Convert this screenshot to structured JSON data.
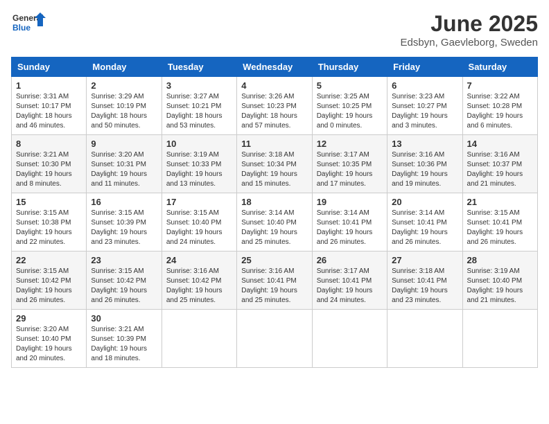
{
  "header": {
    "logo_general": "General",
    "logo_blue": "Blue",
    "title": "June 2025",
    "subtitle": "Edsbyn, Gaevleborg, Sweden"
  },
  "days_of_week": [
    "Sunday",
    "Monday",
    "Tuesday",
    "Wednesday",
    "Thursday",
    "Friday",
    "Saturday"
  ],
  "weeks": [
    [
      {
        "day": "1",
        "info": "Sunrise: 3:31 AM\nSunset: 10:17 PM\nDaylight: 18 hours\nand 46 minutes."
      },
      {
        "day": "2",
        "info": "Sunrise: 3:29 AM\nSunset: 10:19 PM\nDaylight: 18 hours\nand 50 minutes."
      },
      {
        "day": "3",
        "info": "Sunrise: 3:27 AM\nSunset: 10:21 PM\nDaylight: 18 hours\nand 53 minutes."
      },
      {
        "day": "4",
        "info": "Sunrise: 3:26 AM\nSunset: 10:23 PM\nDaylight: 18 hours\nand 57 minutes."
      },
      {
        "day": "5",
        "info": "Sunrise: 3:25 AM\nSunset: 10:25 PM\nDaylight: 19 hours\nand 0 minutes."
      },
      {
        "day": "6",
        "info": "Sunrise: 3:23 AM\nSunset: 10:27 PM\nDaylight: 19 hours\nand 3 minutes."
      },
      {
        "day": "7",
        "info": "Sunrise: 3:22 AM\nSunset: 10:28 PM\nDaylight: 19 hours\nand 6 minutes."
      }
    ],
    [
      {
        "day": "8",
        "info": "Sunrise: 3:21 AM\nSunset: 10:30 PM\nDaylight: 19 hours\nand 8 minutes."
      },
      {
        "day": "9",
        "info": "Sunrise: 3:20 AM\nSunset: 10:31 PM\nDaylight: 19 hours\nand 11 minutes."
      },
      {
        "day": "10",
        "info": "Sunrise: 3:19 AM\nSunset: 10:33 PM\nDaylight: 19 hours\nand 13 minutes."
      },
      {
        "day": "11",
        "info": "Sunrise: 3:18 AM\nSunset: 10:34 PM\nDaylight: 19 hours\nand 15 minutes."
      },
      {
        "day": "12",
        "info": "Sunrise: 3:17 AM\nSunset: 10:35 PM\nDaylight: 19 hours\nand 17 minutes."
      },
      {
        "day": "13",
        "info": "Sunrise: 3:16 AM\nSunset: 10:36 PM\nDaylight: 19 hours\nand 19 minutes."
      },
      {
        "day": "14",
        "info": "Sunrise: 3:16 AM\nSunset: 10:37 PM\nDaylight: 19 hours\nand 21 minutes."
      }
    ],
    [
      {
        "day": "15",
        "info": "Sunrise: 3:15 AM\nSunset: 10:38 PM\nDaylight: 19 hours\nand 22 minutes."
      },
      {
        "day": "16",
        "info": "Sunrise: 3:15 AM\nSunset: 10:39 PM\nDaylight: 19 hours\nand 23 minutes."
      },
      {
        "day": "17",
        "info": "Sunrise: 3:15 AM\nSunset: 10:40 PM\nDaylight: 19 hours\nand 24 minutes."
      },
      {
        "day": "18",
        "info": "Sunrise: 3:14 AM\nSunset: 10:40 PM\nDaylight: 19 hours\nand 25 minutes."
      },
      {
        "day": "19",
        "info": "Sunrise: 3:14 AM\nSunset: 10:41 PM\nDaylight: 19 hours\nand 26 minutes."
      },
      {
        "day": "20",
        "info": "Sunrise: 3:14 AM\nSunset: 10:41 PM\nDaylight: 19 hours\nand 26 minutes."
      },
      {
        "day": "21",
        "info": "Sunrise: 3:15 AM\nSunset: 10:41 PM\nDaylight: 19 hours\nand 26 minutes."
      }
    ],
    [
      {
        "day": "22",
        "info": "Sunrise: 3:15 AM\nSunset: 10:42 PM\nDaylight: 19 hours\nand 26 minutes."
      },
      {
        "day": "23",
        "info": "Sunrise: 3:15 AM\nSunset: 10:42 PM\nDaylight: 19 hours\nand 26 minutes."
      },
      {
        "day": "24",
        "info": "Sunrise: 3:16 AM\nSunset: 10:42 PM\nDaylight: 19 hours\nand 25 minutes."
      },
      {
        "day": "25",
        "info": "Sunrise: 3:16 AM\nSunset: 10:41 PM\nDaylight: 19 hours\nand 25 minutes."
      },
      {
        "day": "26",
        "info": "Sunrise: 3:17 AM\nSunset: 10:41 PM\nDaylight: 19 hours\nand 24 minutes."
      },
      {
        "day": "27",
        "info": "Sunrise: 3:18 AM\nSunset: 10:41 PM\nDaylight: 19 hours\nand 23 minutes."
      },
      {
        "day": "28",
        "info": "Sunrise: 3:19 AM\nSunset: 10:40 PM\nDaylight: 19 hours\nand 21 minutes."
      }
    ],
    [
      {
        "day": "29",
        "info": "Sunrise: 3:20 AM\nSunset: 10:40 PM\nDaylight: 19 hours\nand 20 minutes."
      },
      {
        "day": "30",
        "info": "Sunrise: 3:21 AM\nSunset: 10:39 PM\nDaylight: 19 hours\nand 18 minutes."
      },
      {
        "day": "",
        "info": ""
      },
      {
        "day": "",
        "info": ""
      },
      {
        "day": "",
        "info": ""
      },
      {
        "day": "",
        "info": ""
      },
      {
        "day": "",
        "info": ""
      }
    ]
  ]
}
